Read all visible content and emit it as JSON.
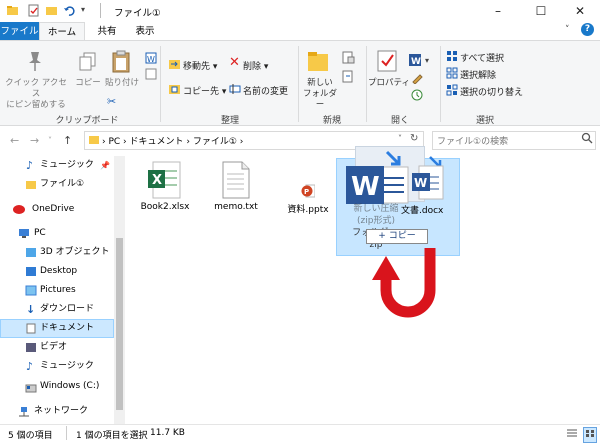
{
  "window": {
    "title": "ファイル①",
    "minimize": "–",
    "maximize": "☐",
    "close": "✕"
  },
  "tabs": {
    "file": "ファイル",
    "home": "ホーム",
    "share": "共有",
    "view": "表示"
  },
  "ribbon": {
    "clipboard": {
      "pin_label_line1": "クイック アクセス",
      "pin_label_line2": "にピン留めする",
      "copy": "コピー",
      "paste": "貼り付け",
      "group": "クリップボード"
    },
    "organize": {
      "move_to": "移動先 ▾",
      "copy_to": "コピー先 ▾",
      "delete": "削除 ▾",
      "rename": "名前の変更",
      "group": "整理"
    },
    "new": {
      "new_folder_line1": "新しい",
      "new_folder_line2": "フォルダー",
      "group": "新規"
    },
    "open": {
      "properties": "プロパティ",
      "group": "開く"
    },
    "select": {
      "select_all": "すべて選択",
      "select_none": "選択解除",
      "invert": "選択の切り替え",
      "group": "選択"
    }
  },
  "address": {
    "path": "›  PC  ›  ドキュメント  ›  ファイル①  ›",
    "search_placeholder": "ファイル①の検索"
  },
  "nav": [
    {
      "label": "ミュージック",
      "icon": "music-icon"
    },
    {
      "label": "ファイル①",
      "icon": "folder-icon"
    },
    {
      "label": "OneDrive",
      "icon": "onedrive-icon"
    },
    {
      "label": "PC",
      "icon": "pc-icon"
    },
    {
      "label": "3D オブジェクト",
      "icon": "3d-objects-icon"
    },
    {
      "label": "Desktop",
      "icon": "desktop-icon"
    },
    {
      "label": "Pictures",
      "icon": "pictures-icon"
    },
    {
      "label": "ダウンロード",
      "icon": "download-icon"
    },
    {
      "label": "ドキュメント",
      "icon": "documents-icon"
    },
    {
      "label": "ビデオ",
      "icon": "video-icon"
    },
    {
      "label": "ミュージック",
      "icon": "music-icon"
    },
    {
      "label": "Windows (C:)",
      "icon": "drive-icon"
    },
    {
      "label": "ネットワーク",
      "icon": "network-icon"
    }
  ],
  "files": [
    {
      "name": "Book2.xlsx",
      "icon": "excel-icon"
    },
    {
      "name": "memo.txt",
      "icon": "text-file-icon"
    },
    {
      "name": "資料.pptx",
      "icon": "powerpoint-icon"
    }
  ],
  "drag": {
    "zip_name_line1": "新しい圧縮",
    "zip_name_line2": "(zip形式)",
    "zip_name_line3": "フォルダー.",
    "zip_name_line4": "zip",
    "docx_name": "文書.docx",
    "copy_tip": "+ コピー",
    "arrow_color": "#d9141c"
  },
  "status": {
    "count": "5 個の項目",
    "selected": "1 個の項目を選択",
    "size": "11.7 KB"
  },
  "colors": {
    "accent": "#1979ca",
    "selection": "#cce8ff"
  }
}
